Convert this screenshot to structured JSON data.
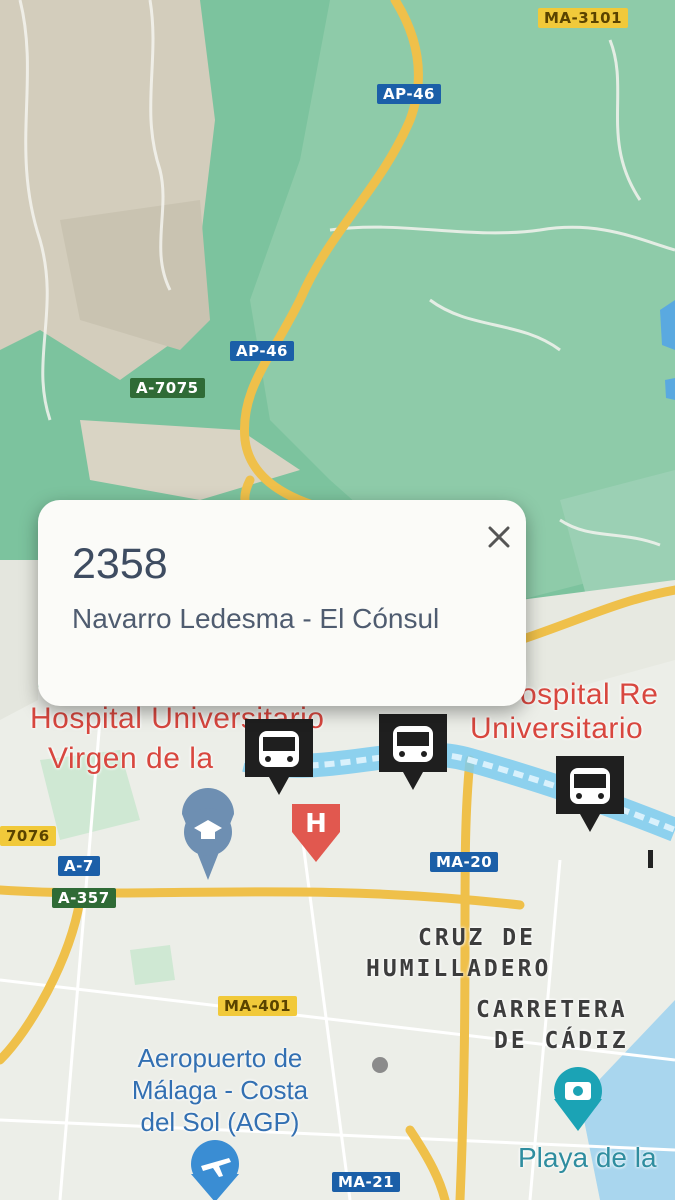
{
  "road_shields": [
    {
      "text": "MA-3101",
      "style": "yellow"
    },
    {
      "text": "AP-46",
      "style": "blue"
    },
    {
      "text": "AP-46",
      "style": "blue"
    },
    {
      "text": "A-7075",
      "style": "green"
    },
    {
      "text": "7076",
      "style": "yellow"
    },
    {
      "text": "A-7",
      "style": "blue"
    },
    {
      "text": "A-357",
      "style": "green"
    },
    {
      "text": "MA-20",
      "style": "blue"
    },
    {
      "text": "MA-401",
      "style": "yellow"
    },
    {
      "text": "MA-21",
      "style": "blue"
    }
  ],
  "place_labels": {
    "hospital_left_line1": "Hospital Universitario",
    "hospital_left_line2": "Virgen de la",
    "hospital_right_line1": "ospital Re",
    "hospital_right_line2": "Universitario",
    "cruz_line1": "CRUZ DE",
    "cruz_line2": "HUMILLADERO",
    "carretera_line1": "CARRETERA",
    "carretera_line2": "DE CÁDIZ",
    "airport_line1": "Aeropuerto de",
    "airport_line2": "Málaga - Costa",
    "airport_line3": "del Sol (AGP)",
    "beach": "Playa de la"
  },
  "icons": {
    "bus_stop": "bus-stop-marker",
    "hospital": "hospital-pin",
    "university": "graduation-cap-pin",
    "camera": "camera-pin",
    "airport": "airplane-pin",
    "close": "close-icon"
  },
  "popup": {
    "title": "2358",
    "subtitle": "Navarro Ledesma - El Cónsul"
  },
  "colors": {
    "terrain_green": "#7dc3a0",
    "terrain_beige": "#d6d2c2",
    "urban": "#eceee8",
    "highway": "#f0c24c",
    "route_line": "#5fb8e6",
    "hospital_red": "#d8473f",
    "marker_dark": "#1f1f1f"
  }
}
